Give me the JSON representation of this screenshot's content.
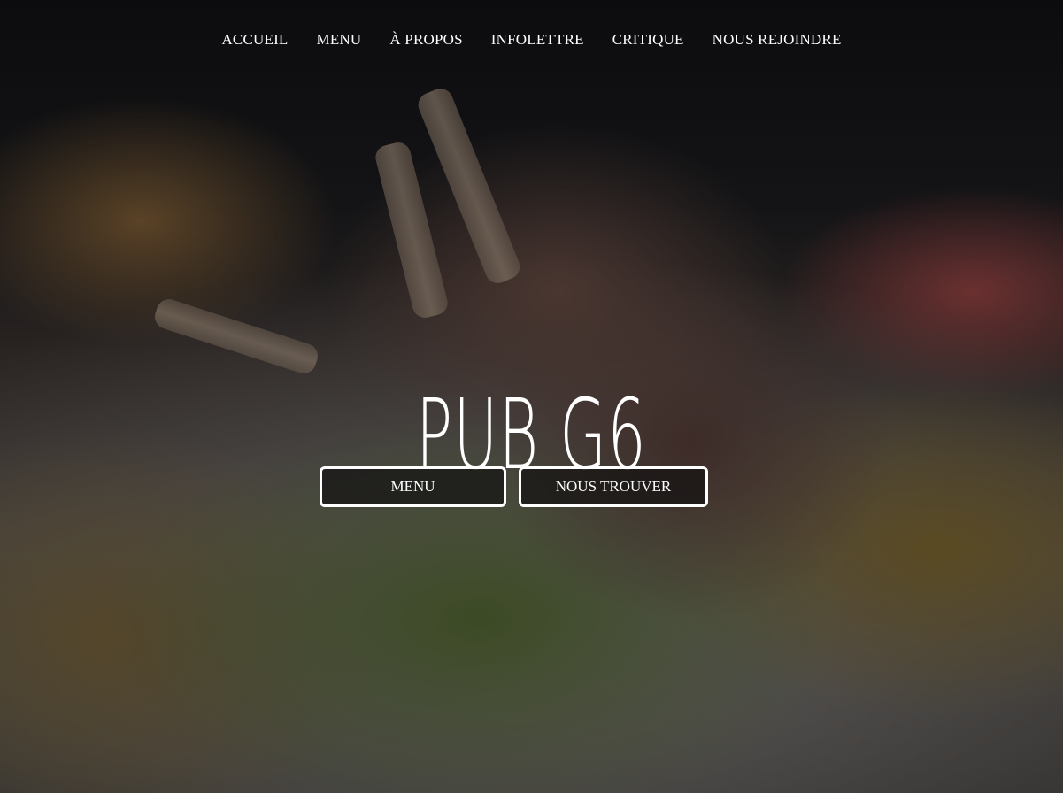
{
  "nav": {
    "items": [
      {
        "label": "ACCUEIL"
      },
      {
        "label": "MENU"
      },
      {
        "label": "À PROPOS"
      },
      {
        "label": "INFOLETTRE"
      },
      {
        "label": "CRITIQUE"
      },
      {
        "label": "NOUS REJOINDRE"
      }
    ]
  },
  "hero": {
    "title": "PUB G6",
    "buttons": {
      "menu_label": "MENU",
      "find_us_label": "NOUS TROUVER"
    }
  },
  "colors": {
    "text": "#ffffff",
    "overlay": "#141212"
  }
}
